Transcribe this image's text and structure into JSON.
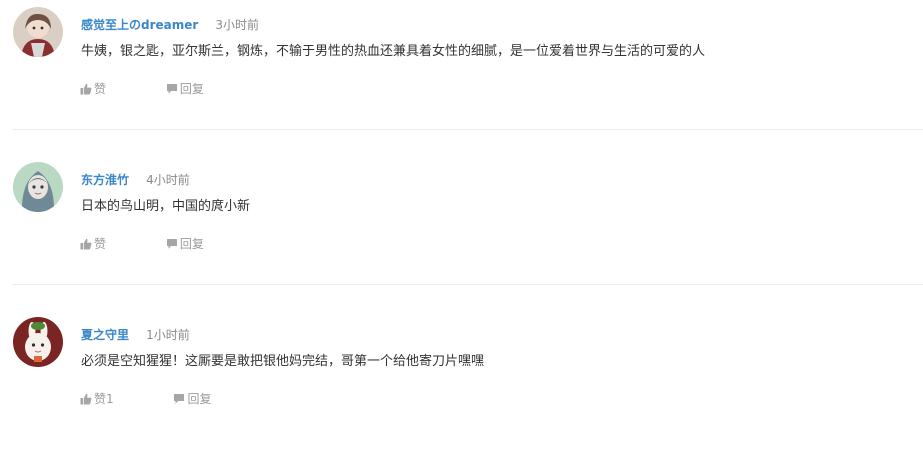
{
  "comments": [
    {
      "username": "感觉至上のdreamer",
      "time": "3小时前",
      "text": "牛姨，银之匙，亚尔斯兰，钢炼，不输于男性的热血还兼具着女性的细腻，是一位爱着世界与生活的可爱的人",
      "like_label": "赞",
      "reply_label": "回复"
    },
    {
      "username": "东方淮竹",
      "time": "4小时前",
      "text": "日本的鸟山明，中国的庹小新",
      "like_label": "赞",
      "reply_label": "回复"
    },
    {
      "username": "夏之守里",
      "time": "1小时前",
      "text": "必须是空知猩猩！这厮要是敢把银他妈完结，哥第一个给他寄刀片嘿嘿",
      "like_label": "赞1",
      "reply_label": "回复"
    }
  ],
  "icons": {
    "like": "thumbs-up-icon",
    "reply": "speech-bubble-icon"
  },
  "colors": {
    "username": "#3a87c8",
    "time": "#8a8a8a",
    "text": "#333333",
    "action": "#9a9a9a",
    "divider": "#eeeeee"
  }
}
